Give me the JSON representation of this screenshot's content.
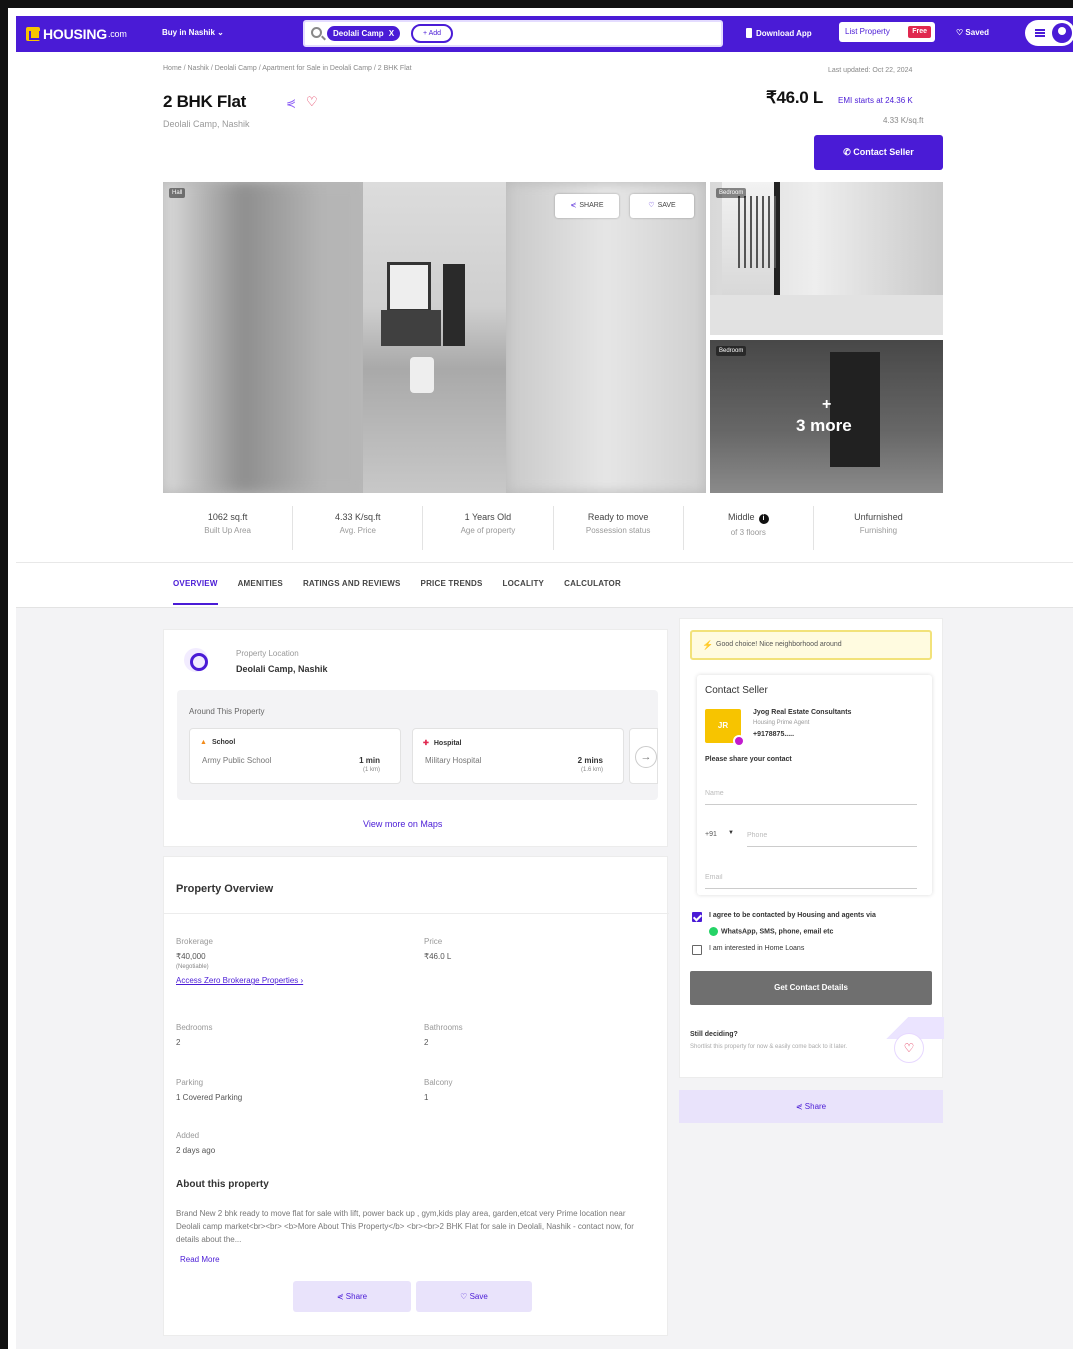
{
  "nav": {
    "logo": "HOUSING",
    "logo_suffix": ".com",
    "city_select": "Buy in Nashik",
    "search_chip": "Deolali Camp",
    "search_chip_close": "X",
    "search_add": "+ Add",
    "download_app": "Download App",
    "list_property": "List Property",
    "list_property_badge": "Free",
    "saved": "Saved"
  },
  "header": {
    "breadcrumb": "Home / Nashik / Deolali Camp / Apartment for Sale in Deolali Camp / 2 BHK Flat",
    "last_updated": "Last updated: Oct 22, 2024",
    "title": "2 BHK Flat",
    "subtitle": "Deolali Camp, Nashik",
    "price": "₹46.0 L",
    "emi": "EMI starts at 24.36 K",
    "price_per_sqft": "4.33 K/sq.ft",
    "contact_button": "Contact Seller"
  },
  "gallery": {
    "main_tag": "Hall",
    "share": "SHARE",
    "save": "SAVE",
    "thumb1_tag": "Bedroom",
    "thumb2_tag": "Bedroom",
    "more_plus": "+",
    "more_label": "3 more"
  },
  "stats": [
    {
      "value": "1062 sq.ft",
      "label": "Built Up Area"
    },
    {
      "value": "4.33 K/sq.ft",
      "label": "Avg. Price"
    },
    {
      "value": "1 Years Old",
      "label": "Age of property"
    },
    {
      "value": "Ready to move",
      "label": "Possession status"
    },
    {
      "value": "Middle",
      "label": "of 3 floors"
    },
    {
      "value": "Unfurnished",
      "label": "Furnishing"
    }
  ],
  "tabs": [
    "OVERVIEW",
    "AMENITIES",
    "RATINGS AND REVIEWS",
    "PRICE TRENDS",
    "LOCALITY",
    "CALCULATOR"
  ],
  "location": {
    "label": "Property Location",
    "value": "Deolali Camp, Nashik",
    "around_title": "Around This Property",
    "pois": [
      {
        "category": "School",
        "name": "Army Public School",
        "duration": "1 min",
        "distance": "(1 km)"
      },
      {
        "category": "Hospital",
        "name": "Military Hospital",
        "duration": "2 mins",
        "distance": "(1.6 km)"
      }
    ],
    "view_maps": "View more on Maps"
  },
  "overview": {
    "title": "Property Overview",
    "brokerage_label": "Brokerage",
    "brokerage_value": "₹40,000",
    "brokerage_note": "(Negotiable)",
    "brokerage_link": "Access Zero Brokerage Properties ›",
    "price_label": "Price",
    "price_value": "₹46.0 L",
    "bedrooms_label": "Bedrooms",
    "bedrooms_value": "2",
    "bathrooms_label": "Bathrooms",
    "bathrooms_value": "2",
    "parking_label": "Parking",
    "parking_value": "1 Covered Parking",
    "balcony_label": "Balcony",
    "balcony_value": "1",
    "added_label": "Added",
    "added_value": "2 days ago",
    "about_title": "About this property",
    "about_text": "Brand New 2 bhk ready to move flat for sale with lift, power back up , gym,kids play area, garden,etcat very Prime location near Deolali camp market<br><br> <b>More About This Property</b> <br><br>2 BHK Flat for sale in Deolali, Nashik - contact now, for details about the...",
    "read_more": "Read More",
    "share": "Share",
    "save": "Save"
  },
  "contact": {
    "banner": "Good choice! Nice neighborhood around",
    "title": "Contact Seller",
    "agent_initials": "JR",
    "agent_name": "Jyog Real Estate Consultants",
    "agent_role": "Housing Prime Agent",
    "agent_phone": "+9178875.....",
    "share_prompt": "Please share your contact",
    "name_placeholder": "Name",
    "country_code": "+91",
    "phone_placeholder": "Phone",
    "email_placeholder": "Email",
    "consent_line1": "I agree to be contacted by Housing and agents via",
    "consent_line2": "WhatsApp, SMS, phone, email etc",
    "home_loans": "I am interested in Home Loans",
    "get_details": "Get Contact Details",
    "still_deciding": "Still deciding?",
    "still_sub": "Shortlist this property for now & easily come back to it later.",
    "share": "Share"
  },
  "colors": {
    "brand": "#4a1bd6",
    "accent_yellow": "#f7c400",
    "badge_red": "#e0284f"
  }
}
